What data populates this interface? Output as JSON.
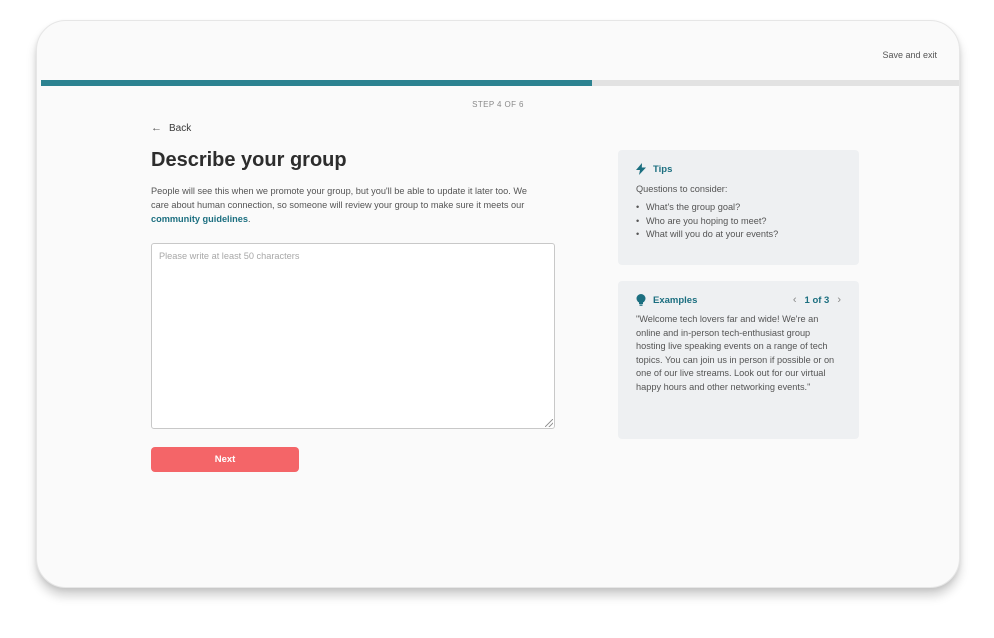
{
  "header": {
    "save_exit": "Save and exit"
  },
  "progress": {
    "fraction": 0.6,
    "step_label": "STEP 4 OF 6"
  },
  "nav": {
    "back": "Back"
  },
  "main": {
    "title": "Describe your group",
    "description_pre": "People will see this when we promote your group, but you'll be able to update it later too.  We care about human connection, so someone will review your group to make sure it meets our ",
    "description_link": "community guidelines",
    "description_post": ".",
    "textarea": {
      "value": "",
      "placeholder": "Please write at least 50 characters"
    },
    "next_label": "Next"
  },
  "tips": {
    "heading": "Tips",
    "subheading": "Questions to consider:",
    "items": [
      "What's the group goal?",
      "Who are you hoping to meet?",
      "What will you do at your events?"
    ]
  },
  "examples": {
    "heading": "Examples",
    "pager": "1 of 3",
    "quote": "\"Welcome tech lovers far and wide! We're an online and in-person tech-enthusiast group hosting live speaking events on a range of tech topics. You can join us in person if possible or on one of our live streams. Look out for our virtual happy hours and other networking events.\""
  },
  "icons": {
    "back": "arrow-left-icon",
    "tips": "lightning-icon",
    "examples": "lightbulb-icon",
    "prev": "chevron-left-icon",
    "next": "chevron-right-icon"
  },
  "colors": {
    "accent": "#1c6f80",
    "progress": "#2c8290",
    "button": "#f46568"
  }
}
